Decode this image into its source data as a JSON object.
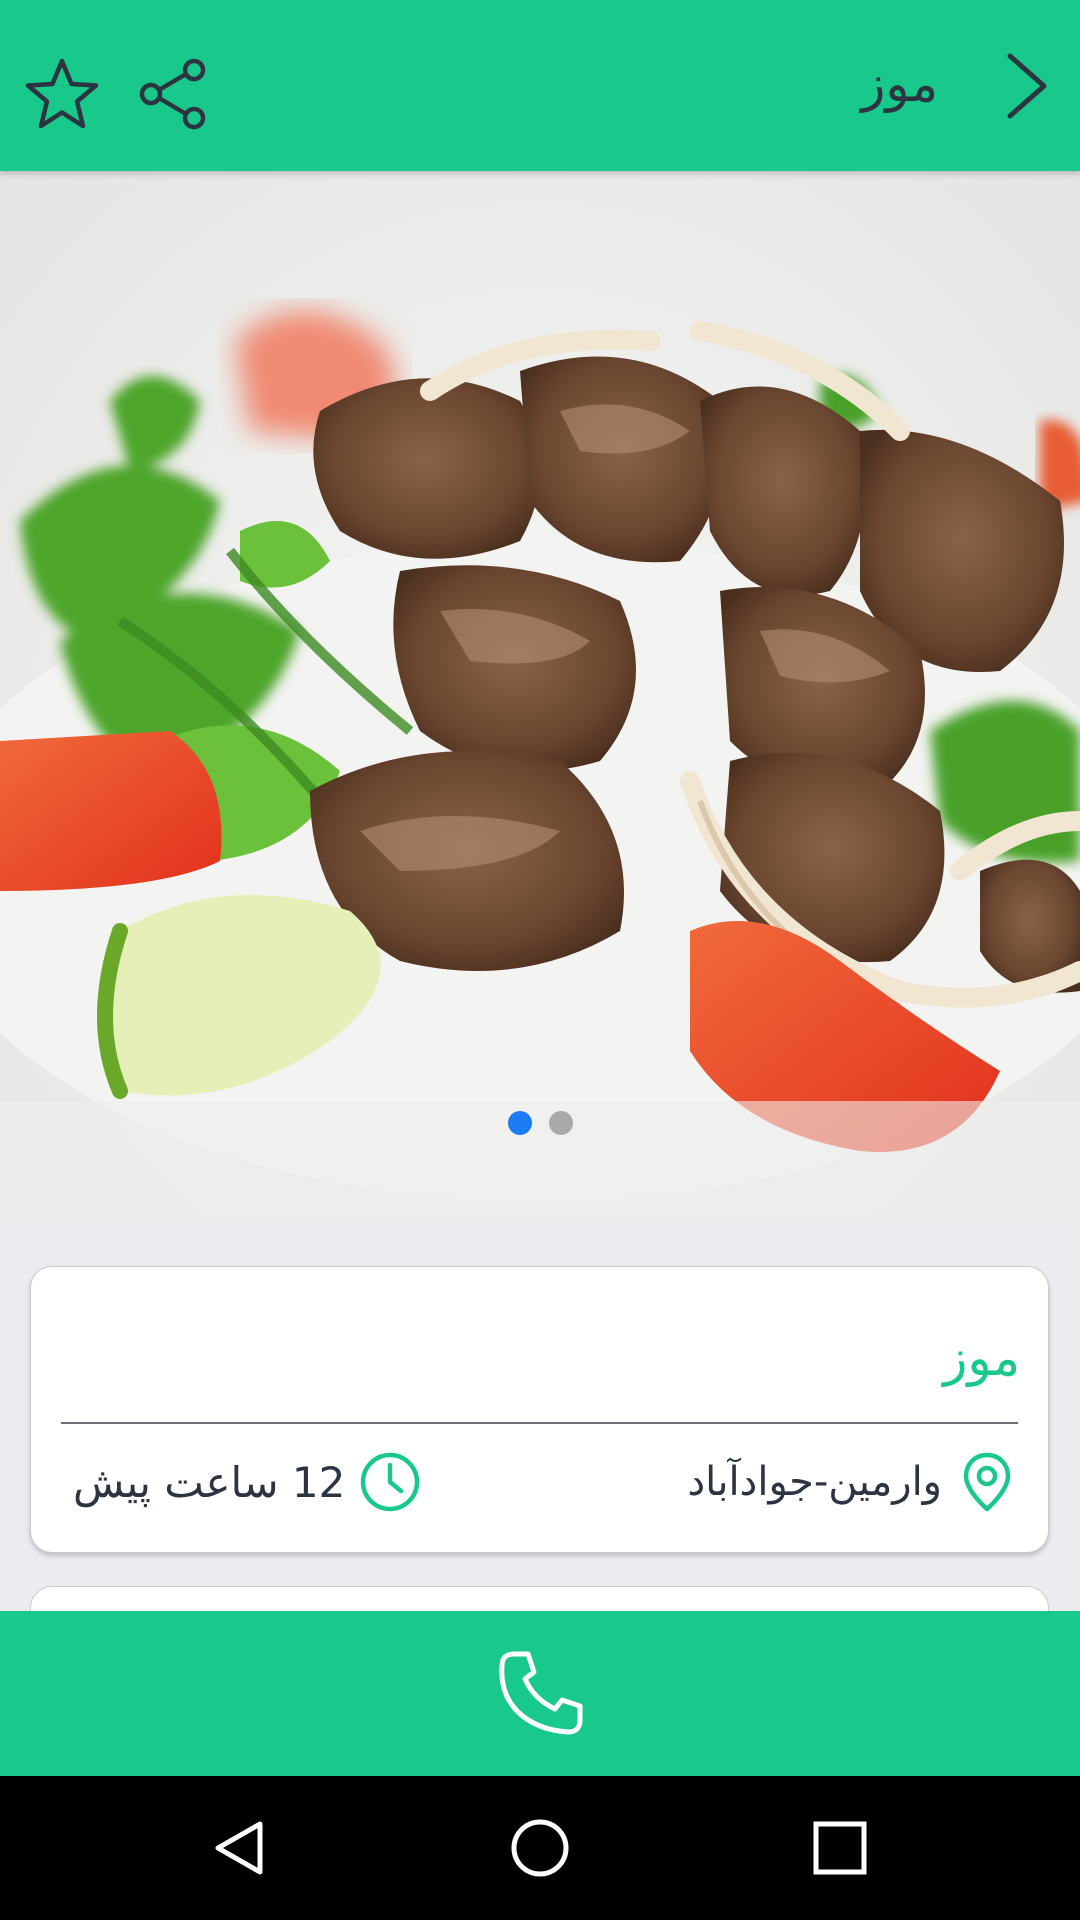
{
  "app_bar": {
    "title": "موز",
    "icons": {
      "back": "chevron-right-icon",
      "share": "share-icon",
      "favorite": "star-outline-icon"
    },
    "background": "#19c98b"
  },
  "hero": {
    "image": "salad-with-beef-photo",
    "pager": {
      "current": 1,
      "total": 2
    }
  },
  "ad": {
    "title": "موز",
    "location": "وارمین-جوادآباد",
    "time": "12 ساعت پیش"
  },
  "call_button": {
    "icon": "phone-icon"
  },
  "nav_bar": {
    "icons": [
      "back-triangle-icon",
      "home-circle-icon",
      "recents-square-icon"
    ]
  },
  "colors": {
    "accent": "#19c98b",
    "text_dark": "#2b3440",
    "active_dot": "#1a7cf0",
    "inactive_dot": "#a9a9a9"
  }
}
